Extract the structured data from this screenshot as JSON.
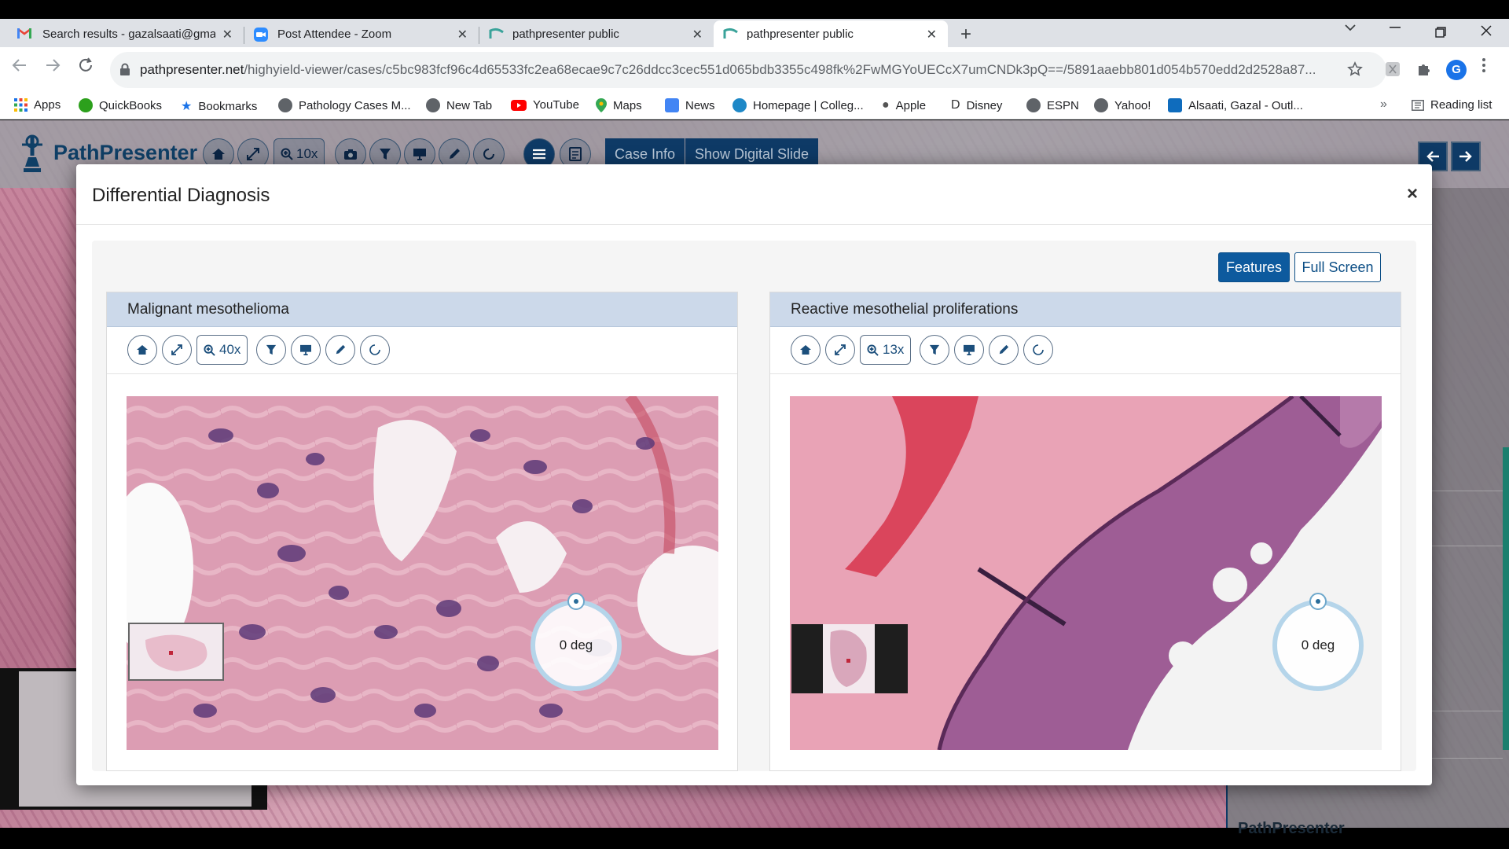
{
  "browser": {
    "tabs": [
      {
        "title": "Search results - gazalsaati@gma",
        "icon": "gmail-icon",
        "close": "✕"
      },
      {
        "title": "Post Attendee - Zoom",
        "icon": "zoom-icon",
        "close": "✕"
      },
      {
        "title": "pathpresenter public",
        "icon": "pathpresenter-icon",
        "close": "✕"
      },
      {
        "title": "pathpresenter public",
        "icon": "pathpresenter-icon",
        "close": "✕",
        "active": true
      }
    ],
    "new_tab": "+",
    "url_host": "pathpresenter.net",
    "url_path": "/highyield-viewer/cases/c5bc983fcf96c4d65533fc2ea68ecae9c7c26ddcc3cec551d065bdb3355c498fk%2FwMGYoUECcX7umCNDk3pQ==/5891aaebb801d054b570edd2d2528a87...",
    "profile_initial": "G",
    "bookmarks": [
      "Apps",
      "QuickBooks",
      "Bookmarks",
      "Pathology Cases M...",
      "New Tab",
      "YouTube",
      "Maps",
      "News",
      "Homepage | Colleg...",
      "Apple",
      "Disney",
      "ESPN",
      "Yahoo!",
      "Alsaati, Gazal - Outl..."
    ],
    "bookmarks_more": "»",
    "reading_list": "Reading list"
  },
  "app": {
    "brand": "PathPresenter",
    "zoom": "10x",
    "case_info": "Case Info",
    "show_digital_slide": "Show Digital Slide",
    "footer_brand": "PathPresenter"
  },
  "modal": {
    "title": "Differential Diagnosis",
    "close": "×",
    "features_button": "Features",
    "full_screen_button": "Full Screen",
    "panels": [
      {
        "title": "Malignant mesothelioma",
        "zoom": "40x",
        "rotation": "0 deg"
      },
      {
        "title": "Reactive mesothelial proliferations",
        "zoom": "13x",
        "rotation": "0 deg"
      }
    ]
  },
  "colors": {
    "primary": "#0d5a9e",
    "panel_header": "#ccd9ea",
    "app_nav_dark": "#0e3a66",
    "stain_pink": "#d98fa9",
    "stain_purple": "#6b3a73"
  }
}
